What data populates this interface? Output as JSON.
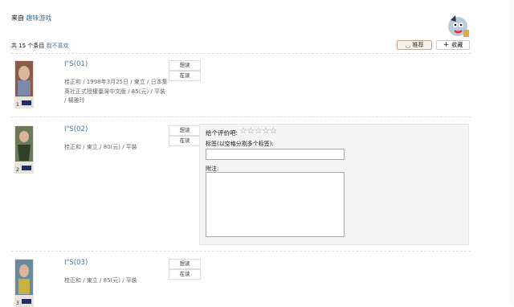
{
  "source": {
    "label": "来自",
    "link": "趣味游戏"
  },
  "header": {
    "count": "共 15 个条目",
    "dislike": "我不喜欢"
  },
  "actions": {
    "recommend": "推荐",
    "collect": "收藏"
  },
  "items": [
    {
      "title": "I\"S(01)",
      "meta": "桂正和 / 1998年3月25日 / 東立 / 日本集英社正式授權臺灣中文版 / 85(元) / 平裝 / 楊雅玲",
      "want": "想读",
      "reading": "在读",
      "cover_num": "1",
      "cover_color": "#8a5a4a"
    },
    {
      "title": "I\"S(02)",
      "meta": "桂正和 / 東立 / 80(元) / 平裝",
      "want": "想读",
      "reading": "在读",
      "cover_num": "2",
      "cover_color": "#6a7a5a"
    },
    {
      "title": "I\"S(03)",
      "meta": "桂正和 / 東立 / 85(元) / 平裝",
      "want": "想读",
      "reading": "在读",
      "cover_num": "3",
      "cover_color": "#6a8aa0"
    }
  ],
  "panel": {
    "rate_label": "给个评价吧:",
    "stars": "☆☆☆☆☆",
    "tag_label": "标签(以空格分割多个标签):",
    "tag_value": "",
    "note_label": "附注:",
    "note_value": ""
  }
}
